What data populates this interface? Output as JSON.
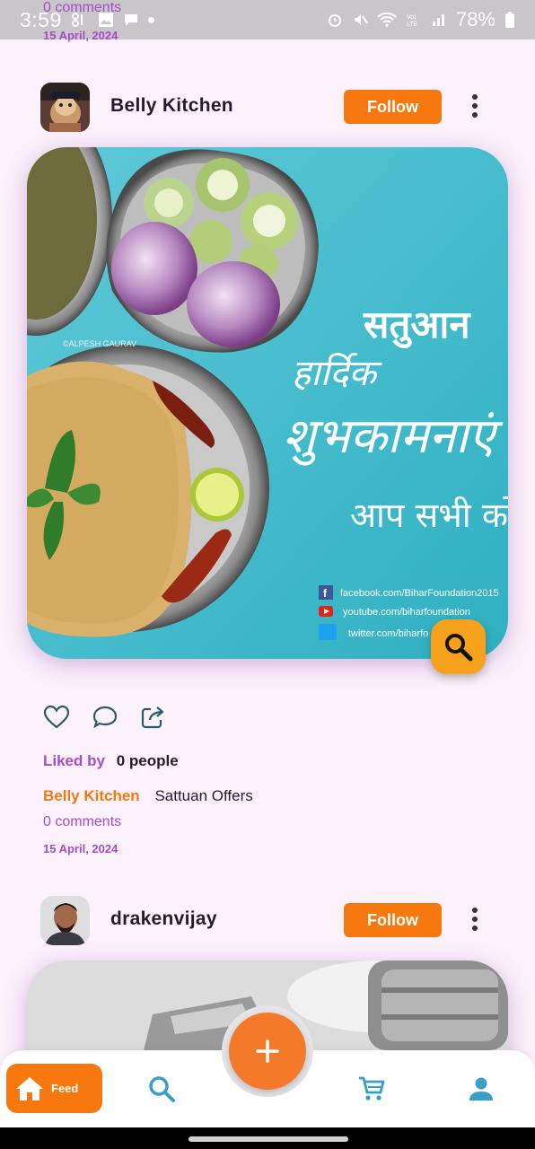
{
  "status_bar": {
    "time": "3:59",
    "battery": "78%"
  },
  "previous_post": {
    "comments": "0 comments",
    "date": "15 April, 2024"
  },
  "posts": [
    {
      "username": "Belly Kitchen",
      "follow_label": "Follow",
      "image_text": {
        "line1": "सतुआन",
        "line2": "हार्दिक",
        "line3": "शुभकामनाएं",
        "line4": "आप सभी को",
        "watermark": "©ALPESH GAURAV",
        "facebook": "facebook.com/BiharFoundation2015",
        "youtube": "youtube.com/biharfoundation",
        "twitter": "twitter.com/biharfo"
      },
      "liked_label": "Liked by",
      "liked_count": "0 people",
      "caption_user": "Belly Kitchen",
      "caption_text": "Sattuan Offers",
      "comments": "0 comments",
      "date": "15 April, 2024"
    },
    {
      "username": "drakenvijay",
      "follow_label": "Follow"
    }
  ],
  "bottom_nav": {
    "feed_label": "Feed"
  },
  "colors": {
    "accent": "#f6780f",
    "purple": "#a64bc9",
    "background": "#fcf2fb"
  }
}
